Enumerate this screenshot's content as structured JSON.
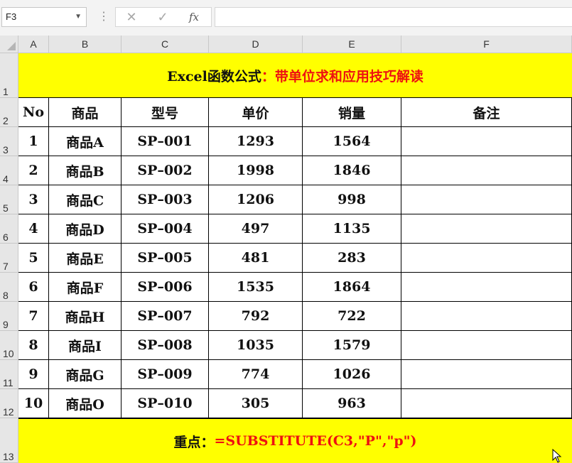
{
  "name_box": {
    "value": "F3"
  },
  "formula_buttons": {
    "cancel": "✕",
    "enter": "✓",
    "fx": "fx"
  },
  "formula_input": {
    "value": ""
  },
  "columns": [
    "A",
    "B",
    "C",
    "D",
    "E",
    "F"
  ],
  "rows": [
    "1",
    "2",
    "3",
    "4",
    "5",
    "6",
    "7",
    "8",
    "9",
    "10",
    "11",
    "12",
    "13"
  ],
  "title": {
    "black": "Excel函数公式",
    "red": "：带单位求和应用技巧解读"
  },
  "table": {
    "headers": [
      "No",
      "商品",
      "型号",
      "单价",
      "销量",
      "备注"
    ],
    "rows": [
      [
        "1",
        "商品A",
        "SP–001",
        "1293",
        "1564",
        ""
      ],
      [
        "2",
        "商品B",
        "SP–002",
        "1998",
        "1846",
        ""
      ],
      [
        "3",
        "商品C",
        "SP–003",
        "1206",
        "998",
        ""
      ],
      [
        "4",
        "商品D",
        "SP–004",
        "497",
        "1135",
        ""
      ],
      [
        "5",
        "商品E",
        "SP–005",
        "481",
        "283",
        ""
      ],
      [
        "6",
        "商品F",
        "SP–006",
        "1535",
        "1864",
        ""
      ],
      [
        "7",
        "商品H",
        "SP–007",
        "792",
        "722",
        ""
      ],
      [
        "8",
        "商品I",
        "SP–008",
        "1035",
        "1579",
        ""
      ],
      [
        "9",
        "商品G",
        "SP–009",
        "774",
        "1026",
        ""
      ],
      [
        "10",
        "商品O",
        "SP–010",
        "305",
        "963",
        ""
      ]
    ]
  },
  "footer": {
    "black": "重点：",
    "red": "=SUBSTITUTE(C3,\"P\",\"p\")"
  },
  "colors": {
    "banner": "#ffff00",
    "accent_red": "#ee1111",
    "header_bg": "#e6e6e6"
  }
}
